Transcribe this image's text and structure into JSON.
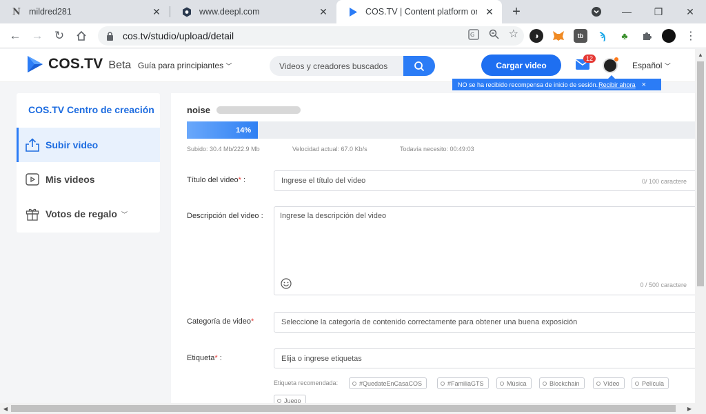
{
  "browser": {
    "tabs": [
      {
        "title": "mildred281",
        "icon": "notion-n-icon"
      },
      {
        "title": "www.deepl.com",
        "icon": "deepl-icon"
      },
      {
        "title": "COS.TV | Content platform on blc",
        "icon": "costv-play-icon"
      }
    ],
    "url": "cos.tv/studio/upload/detail"
  },
  "header": {
    "logo_text": "COS.TV",
    "logo_beta": "Beta",
    "guide": "Guía para principiantes",
    "search_placeholder": "Videos y creadores buscados",
    "upload_button": "Cargar video",
    "mail_count": "12",
    "language": "Español",
    "reward_text": "NO se ha recibido recompensa de inicio de sesión.",
    "reward_link": "Recibir ahora",
    "reward_close": "×"
  },
  "sidebar": {
    "title": "COS.TV Centro de creación",
    "items": [
      {
        "label": "Subir video",
        "icon": "upload-icon"
      },
      {
        "label": "Mis videos",
        "icon": "play-box-icon"
      },
      {
        "label": "Votos de regalo",
        "icon": "gift-icon"
      }
    ]
  },
  "upload": {
    "file_name": "noise",
    "progress_text": "14%",
    "progress": 0.14,
    "uploaded": "Subido: 30.4 Mb/222.9 Mb",
    "speed": "Velocidad actual: 67.0 Kb/s",
    "remaining": "Todavía necesito: 00:49:03"
  },
  "form": {
    "title_label": "Título del video",
    "title_placeholder": "Ingrese el título del video",
    "title_counter": "0/ 100 caractere",
    "desc_label": "Descripción del video :",
    "desc_placeholder": "Ingrese la descripción del video",
    "desc_counter": "0 / 500 caractere",
    "category_label": "Categoría de video",
    "category_placeholder": "Seleccione la categoría de contenido correctamente para obtener una buena exposición",
    "tag_label": "Etiqueta",
    "tag_placeholder": "Elija o ingrese etiquetas",
    "recommended_label": "Etiqueta recomendada:",
    "tags": [
      "#QuedateEnCasaCOS",
      "#FamiliaGTS",
      "Música",
      "Blockchain",
      "Vídeo",
      "Película",
      "Juego"
    ]
  }
}
